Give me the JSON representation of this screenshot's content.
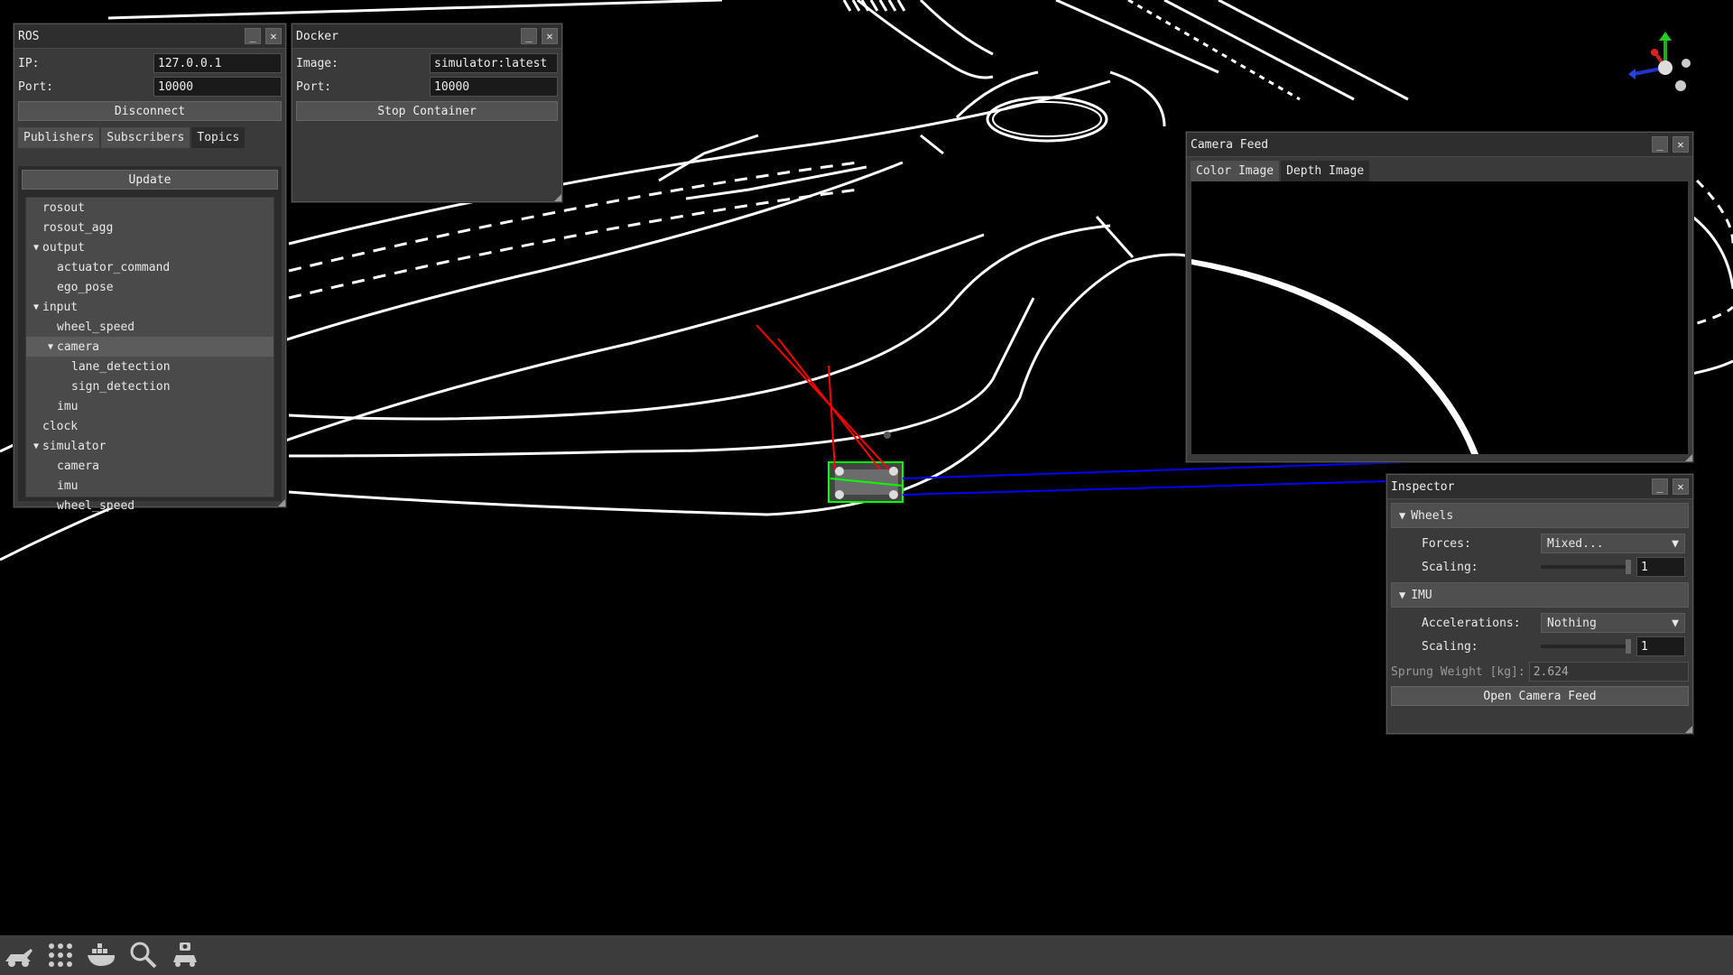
{
  "ros_window": {
    "title": "ROS",
    "ip_label": "IP:",
    "ip_value": "127.0.0.1",
    "port_label": "Port:",
    "port_value": "10000",
    "disconnect_label": "Disconnect",
    "tabs": [
      "Publishers",
      "Subscribers",
      "Topics"
    ],
    "active_tab": "Topics",
    "update_label": "Update",
    "topics": [
      {
        "label": "rosout",
        "depth": 0,
        "arrow": ""
      },
      {
        "label": "rosout_agg",
        "depth": 0,
        "arrow": ""
      },
      {
        "label": "output",
        "depth": 0,
        "arrow": "▼"
      },
      {
        "label": "actuator_command",
        "depth": 1,
        "arrow": ""
      },
      {
        "label": "ego_pose",
        "depth": 1,
        "arrow": ""
      },
      {
        "label": "input",
        "depth": 0,
        "arrow": "▼"
      },
      {
        "label": "wheel_speed",
        "depth": 1,
        "arrow": ""
      },
      {
        "label": "camera",
        "depth": 1,
        "arrow": "▼",
        "selected": true
      },
      {
        "label": "lane_detection",
        "depth": 2,
        "arrow": ""
      },
      {
        "label": "sign_detection",
        "depth": 2,
        "arrow": ""
      },
      {
        "label": "imu",
        "depth": 1,
        "arrow": ""
      },
      {
        "label": "clock",
        "depth": 0,
        "arrow": ""
      },
      {
        "label": "simulator",
        "depth": 0,
        "arrow": "▼"
      },
      {
        "label": "camera",
        "depth": 1,
        "arrow": ""
      },
      {
        "label": "imu",
        "depth": 1,
        "arrow": ""
      },
      {
        "label": "wheel_speed",
        "depth": 1,
        "arrow": ""
      }
    ]
  },
  "docker_window": {
    "title": "Docker",
    "image_label": "Image:",
    "image_value": "simulator:latest",
    "port_label": "Port:",
    "port_value": "10000",
    "stop_label": "Stop Container"
  },
  "camera_window": {
    "title": "Camera Feed",
    "tabs": [
      "Color Image",
      "Depth Image"
    ],
    "active_tab": "Depth Image"
  },
  "inspector_window": {
    "title": "Inspector",
    "wheels_header": "Wheels",
    "forces_label": "Forces:",
    "forces_value": "Mixed...",
    "scaling_label": "Scaling:",
    "wheels_scaling_value": "1",
    "imu_header": "IMU",
    "accelerations_label": "Accelerations:",
    "accelerations_value": "Nothing",
    "imu_scaling_value": "1",
    "sprung_weight_label": "Sprung Weight [kg]:",
    "sprung_weight_value": "2.624",
    "open_camera_label": "Open Camera Feed"
  },
  "window_buttons": {
    "minimize": "_",
    "close": "✕"
  },
  "taskbar": {
    "icons": [
      "car-lift-icon",
      "apps-grid-icon",
      "docker-icon",
      "search-icon",
      "camera-car-icon"
    ]
  },
  "colors": {
    "background": "#000000",
    "panel": "#3a3a3a",
    "road_lines": "#ffffff",
    "vehicle_box": "#00ff00",
    "ray_red": "#ff0000",
    "link_blue": "#0000ff"
  }
}
